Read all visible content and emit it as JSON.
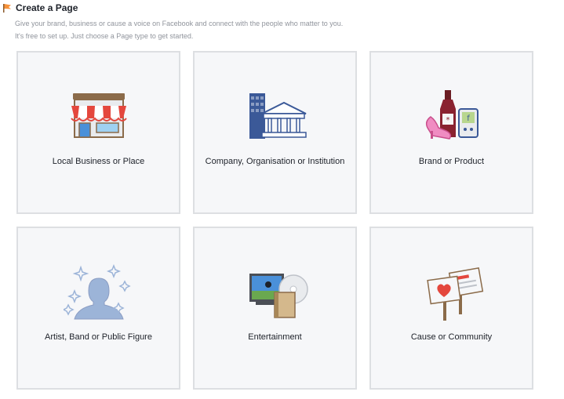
{
  "header": {
    "icon": "flag-icon",
    "title": "Create a Page",
    "description_line1": "Give your brand, business or cause a voice on Facebook and connect with the people who matter to you.",
    "description_line2": "It's free to set up. Just choose a Page type to get started."
  },
  "page_types": [
    {
      "label": "Local Business or Place",
      "icon": "storefront-icon"
    },
    {
      "label": "Company, Organisation or Institution",
      "icon": "building-icon"
    },
    {
      "label": "Brand or Product",
      "icon": "products-icon"
    },
    {
      "label": "Artist, Band or Public Figure",
      "icon": "person-silhouette-icon"
    },
    {
      "label": "Entertainment",
      "icon": "media-icon"
    },
    {
      "label": "Cause or Community",
      "icon": "signs-icon"
    }
  ]
}
